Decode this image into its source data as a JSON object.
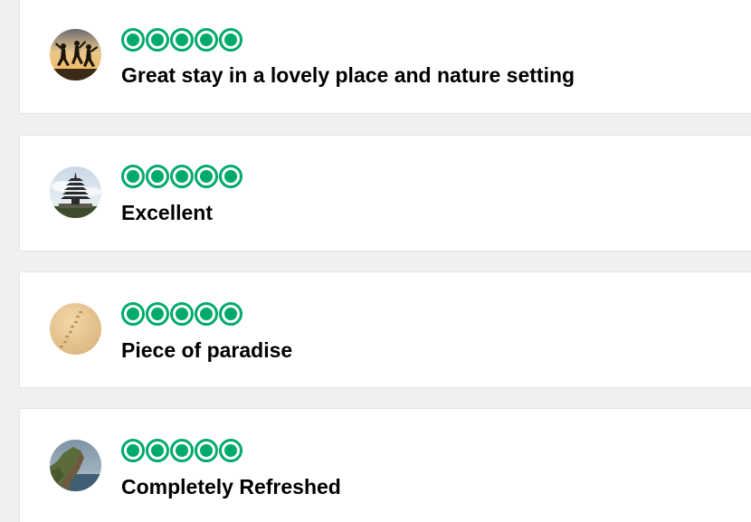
{
  "reviews": [
    {
      "rating": 5,
      "rating_max": 5,
      "title": "Great stay in a lovely place and nature setting",
      "avatar_icon": "people-jumping-sunset-avatar"
    },
    {
      "rating": 5,
      "rating_max": 5,
      "title": "Excellent",
      "avatar_icon": "pagoda-temple-avatar"
    },
    {
      "rating": 5,
      "rating_max": 5,
      "title": "Piece of paradise",
      "avatar_icon": "footprints-sand-avatar"
    },
    {
      "rating": 5,
      "rating_max": 5,
      "title": "Completely Refreshed",
      "avatar_icon": "sea-cliff-avatar"
    }
  ],
  "colors": {
    "bubble_green": "#00aa6c",
    "page_background": "#f0f0f0",
    "card_background": "#ffffff",
    "title_text": "#000000"
  }
}
